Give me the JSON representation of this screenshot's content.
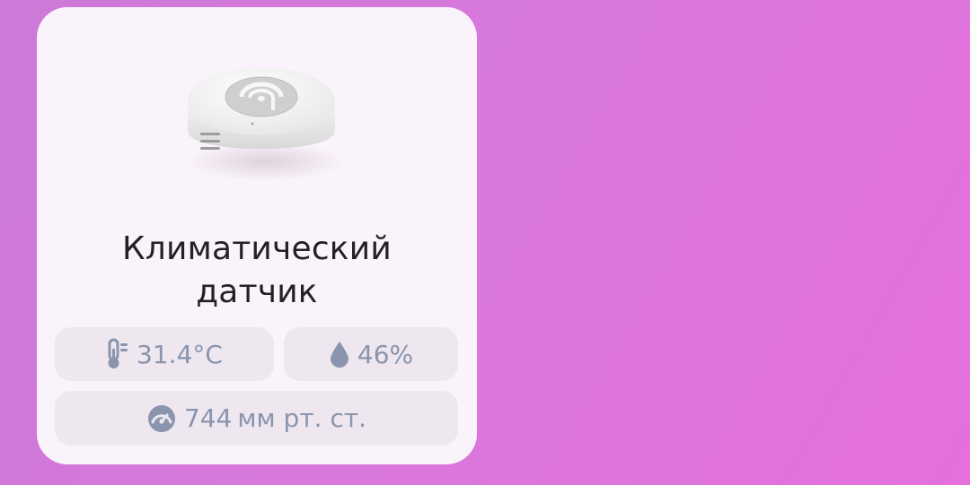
{
  "card": {
    "title_line1": "Климатический",
    "title_line2": "датчик",
    "device_image": "climate-sensor-device"
  },
  "readings": {
    "temperature": {
      "icon": "thermometer-icon",
      "value": "31.4°C"
    },
    "humidity": {
      "icon": "water-drop-icon",
      "value": "46%"
    },
    "pressure": {
      "icon": "gauge-icon",
      "value": "744",
      "unit": "мм рт. ст."
    }
  },
  "colors": {
    "background_start": "#cc79d8",
    "background_end": "#e46fdd",
    "card": "#fbf3fb",
    "pill": "#eee7ef",
    "reading_text": "#8a94ad",
    "title_text": "#222222"
  }
}
